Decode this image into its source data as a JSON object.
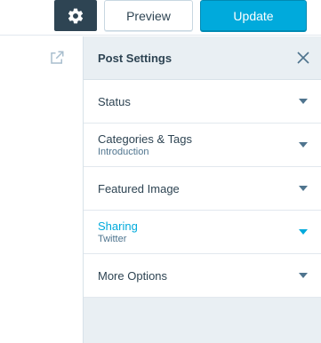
{
  "toolbar": {
    "settings_icon": "gear-icon",
    "preview_label": "Preview",
    "update_label": "Update"
  },
  "editor": {
    "external_link_icon": "external-link-icon"
  },
  "sidebar": {
    "title": "Post Settings",
    "close_icon": "close-icon",
    "sections": [
      {
        "label": "Status",
        "sub": ""
      },
      {
        "label": "Categories & Tags",
        "sub": "Introduction"
      },
      {
        "label": "Featured Image",
        "sub": ""
      },
      {
        "label": "Sharing",
        "sub": "Twitter",
        "active": true
      },
      {
        "label": "More Options",
        "sub": ""
      }
    ]
  },
  "colors": {
    "accent": "#00aadc",
    "dark": "#2e4453",
    "panel_bg": "#e9eff3",
    "subtext": "#4f748e"
  }
}
